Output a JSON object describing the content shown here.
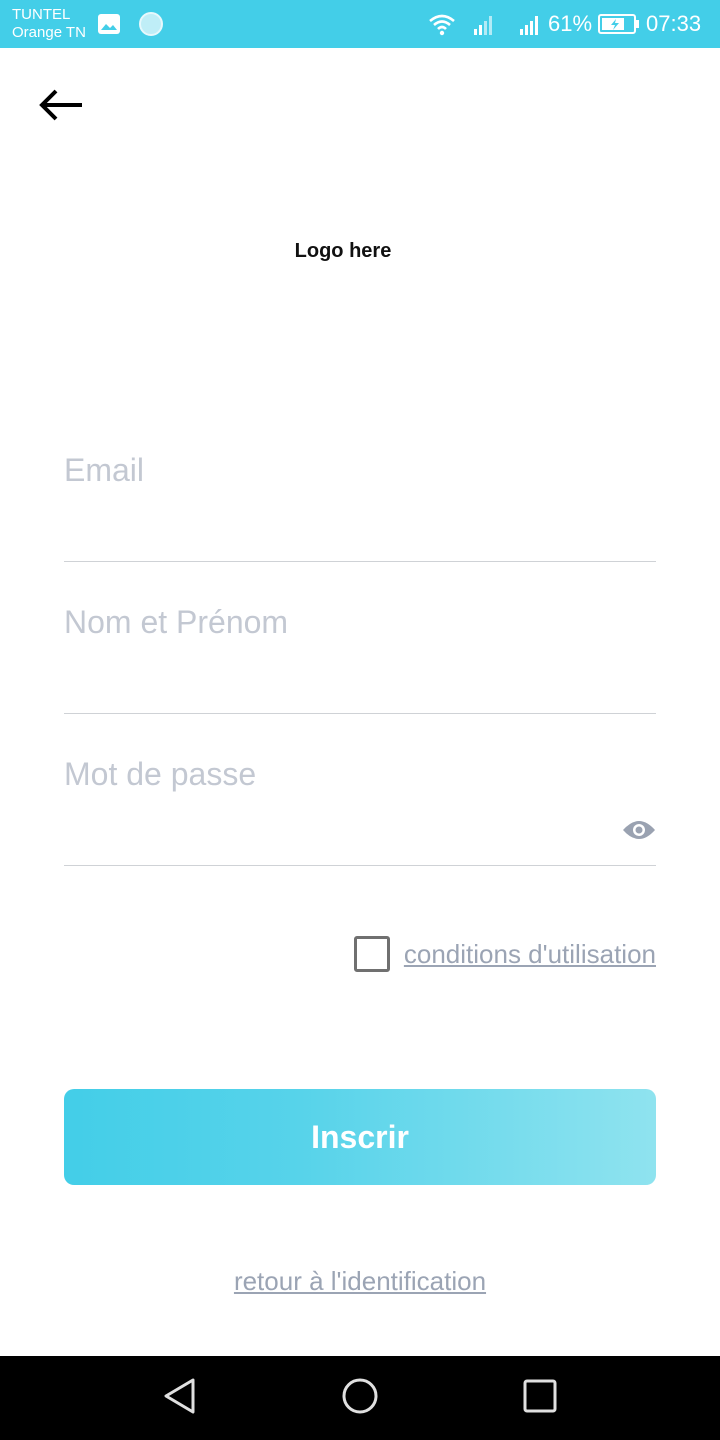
{
  "status_bar": {
    "carrier_line1": "TUNTEL",
    "carrier_line2": "Orange TN",
    "battery_percent": "61%",
    "time": "07:33",
    "icons": [
      "gallery-icon",
      "sync-icon",
      "wifi-icon",
      "signal-icon",
      "signal-icon",
      "battery-charging-icon"
    ],
    "background_color": "#43cee8"
  },
  "header": {
    "back_icon": "arrow-left-icon",
    "logo_text": "Logo here"
  },
  "form": {
    "email": {
      "placeholder": "Email",
      "value": ""
    },
    "full_name": {
      "placeholder": "Nom et Prénom",
      "value": ""
    },
    "password": {
      "placeholder": "Mot de passe",
      "value": "",
      "toggle_icon": "eye-icon"
    },
    "terms": {
      "checked": false,
      "label": "conditions d'utilisation"
    },
    "submit_label": "Inscrir"
  },
  "footer": {
    "back_to_login": "retour à l'identification"
  },
  "nav_bar": {
    "icons": [
      "back-triangle-icon",
      "home-circle-icon",
      "recent-square-icon"
    ]
  },
  "colors": {
    "accent": "#43cee8",
    "placeholder": "#c3c8d2",
    "link": "#9ba4b4"
  }
}
